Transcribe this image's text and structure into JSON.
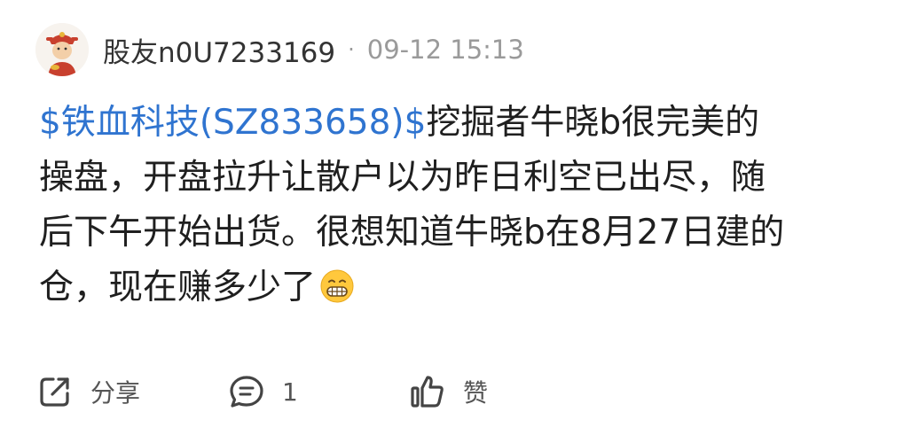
{
  "post": {
    "username": "股友n0U7233169",
    "separator": "·",
    "time": "09-12 15:13",
    "stock_tag": "$铁血科技(SZ833658)$",
    "content_line1_rest": "挖掘者牛晓b很完美的",
    "content_line2": "操盘，开盘拉升让散户以为昨日利空已出尽，随",
    "content_line3": "后下午开始出货。很想知道牛晓b在8月27日建的",
    "content_line4": "仓，现在赚多少了",
    "emoji": "grimacing-face"
  },
  "actions": {
    "share_label": "分享",
    "comment_count": "1",
    "like_label": "赞"
  },
  "colors": {
    "link": "#2f74d0",
    "meta": "#9a9a9a",
    "text": "#1f1f1f"
  }
}
